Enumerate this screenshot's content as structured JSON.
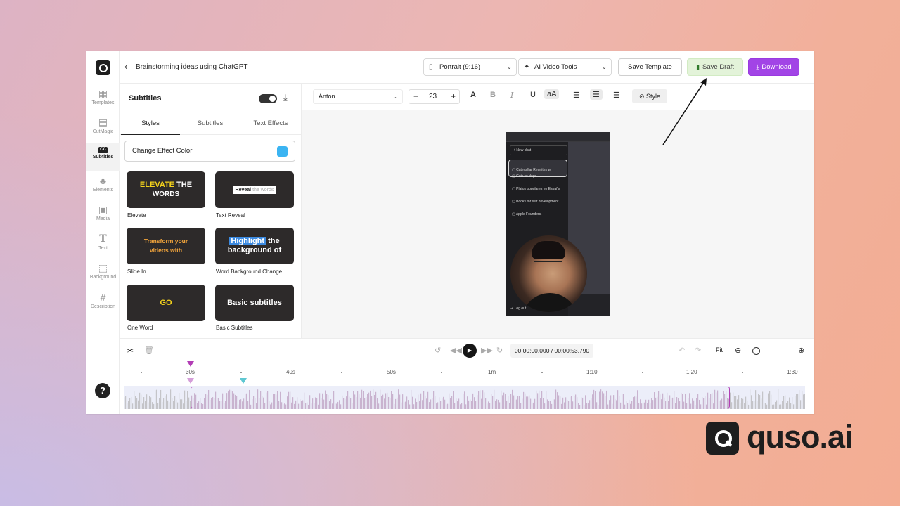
{
  "app": {
    "project_title": "Brainstorming ideas using ChatGPT",
    "aspect_select": "Portrait (9:16)",
    "ai_tools_select": "AI Video Tools",
    "save_template_label": "Save Template",
    "save_draft_label": "Save Draft",
    "download_label": "Download",
    "accent_color": "#a244e6",
    "draft_color": "#e3f3d9"
  },
  "sidebar": {
    "items": [
      {
        "label": "Templates",
        "icon": "templates-icon"
      },
      {
        "label": "CutMagic",
        "icon": "cutmagic-icon"
      },
      {
        "label": "Subtitles",
        "icon": "cc-icon",
        "badge": "CC",
        "active": true
      },
      {
        "label": "Elements",
        "icon": "elements-icon"
      },
      {
        "label": "Media",
        "icon": "media-icon"
      },
      {
        "label": "Text",
        "icon": "text-icon"
      },
      {
        "label": "Background",
        "icon": "background-icon"
      },
      {
        "label": "Description",
        "icon": "hashtag-icon"
      }
    ],
    "help_label": "?"
  },
  "panel": {
    "title": "Subtitles",
    "tabs": [
      "Styles",
      "Subtitles",
      "Text Effects"
    ],
    "active_tab": "Styles",
    "effect_color_label": "Change Effect Color",
    "effect_color": "#3bb4f2",
    "styles": [
      {
        "name": "Elevate",
        "preview_a": "ELEVATE",
        "preview_b": "THE",
        "preview_c": "WORDS"
      },
      {
        "name": "Text Reveal",
        "preview_a": "Reveal",
        "preview_b": "the words"
      },
      {
        "name": "Slide In",
        "preview_a": "Transform your",
        "preview_b": "videos with"
      },
      {
        "name": "Word Background Change",
        "preview_a": "Highlight",
        "preview_b": "the",
        "preview_c": "background of"
      },
      {
        "name": "One Word",
        "preview_a": "GO"
      },
      {
        "name": "Basic Subtitles",
        "preview_a": "Basic subtitles"
      }
    ]
  },
  "format": {
    "font": "Anton",
    "size": "23",
    "style_label": "Style"
  },
  "preview": {
    "new_chat": "New chat",
    "chats": [
      "Caterpillar Reunites wi",
      "Cats vs dogs.",
      "Platos populares en España",
      "Books for self development",
      "Apple Founders."
    ],
    "logout": "Log out"
  },
  "timeline": {
    "timecode": "00:00:00.000 / 00:00:53.790",
    "fit_label": "Fit",
    "ruler": [
      "30s",
      "40s",
      "50s",
      "1m",
      "1:10",
      "1:20",
      "1:30"
    ]
  },
  "brand": {
    "name": "quso.ai"
  }
}
